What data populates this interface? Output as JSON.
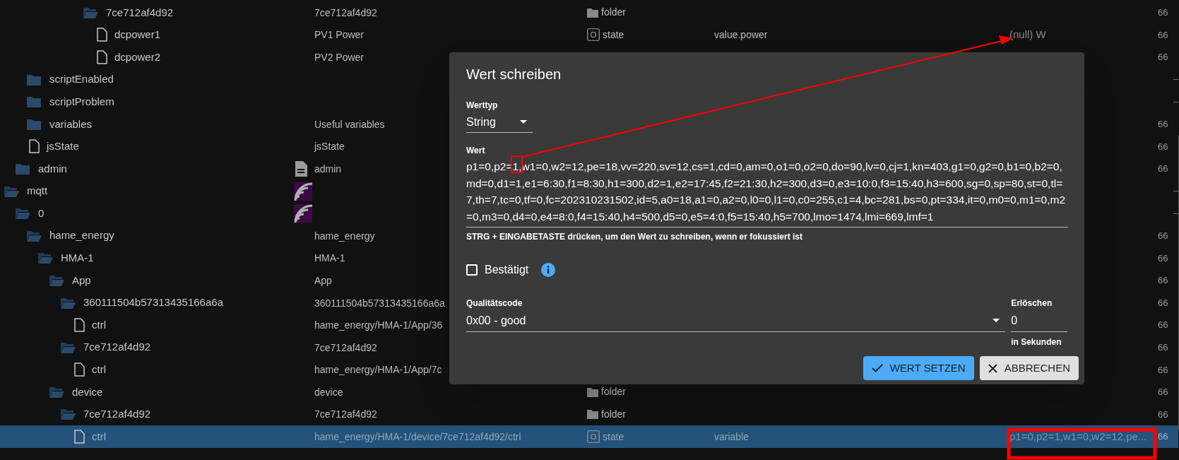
{
  "tree": [
    {
      "children": [
        {
          "children": [
            {
              "children": [
                {
                  "children": [
                    {
                      "children": [
                        {
                          "children": [
                            {
                              "children": [
                                {
                                  "name": "7ce712af4d92",
                                  "kind": "folder",
                                  "expanded": true,
                                  "selected": false,
                                  "title": "7ce712af4d92",
                                  "type": {
                                    "kind": "folder",
                                    "label": "folder"
                                  },
                                  "time": "66",
                                  "children": [
                                    {
                                      "name": "dcpower1",
                                      "kind": "file",
                                      "selected": false,
                                      "title": "PV1 Power",
                                      "type": {
                                        "kind": "state",
                                        "label": "state"
                                      },
                                      "role": "value.power",
                                      "value": "(null) W",
                                      "time": "66"
                                    },
                                    {
                                      "name": "dcpower2",
                                      "kind": "file",
                                      "selected": false,
                                      "title": "PV2 Power",
                                      "time": "66"
                                    }
                                  ]
                                }
                              ]
                            }
                          ]
                        }
                      ]
                    }
                  ]
                }
              ]
            },
            {
              "name": "scriptEnabled",
              "kind": "folder",
              "expanded": false,
              "selected": false
            },
            {
              "name": "scriptProblem",
              "kind": "folder",
              "expanded": false,
              "selected": false
            },
            {
              "name": "variables",
              "kind": "folder",
              "expanded": false,
              "selected": false,
              "title": "Useful variables",
              "time": "66"
            },
            {
              "name": "jsState",
              "kind": "file",
              "selected": false,
              "title": "jsState",
              "time": "66"
            }
          ]
        },
        {
          "name": "admin",
          "kind": "folder",
          "expanded": false,
          "selected": false,
          "title_icon": {
            "kind": "document"
          },
          "title": "admin",
          "time": "66"
        }
      ]
    },
    {
      "name": "mqtt",
      "kind": "folder",
      "expanded": true,
      "selected": false,
      "title_icon": {
        "kind": "adapter"
      },
      "children": [
        {
          "name": "0",
          "kind": "folder",
          "expanded": true,
          "selected": false,
          "title_icon": {
            "kind": "adapter"
          },
          "children": [
            {
              "name": "hame_energy",
              "kind": "folder",
              "expanded": true,
              "selected": false,
              "title": "hame_energy",
              "time": "66",
              "children": [
                {
                  "name": "HMA-1",
                  "kind": "folder",
                  "expanded": true,
                  "selected": false,
                  "title": "HMA-1",
                  "time": "66",
                  "children": [
                    {
                      "name": "App",
                      "kind": "folder",
                      "expanded": true,
                      "selected": false,
                      "title": "App",
                      "time": "66",
                      "children": [
                        {
                          "name": "360111504b57313435166a6a",
                          "kind": "folder",
                          "expanded": true,
                          "selected": false,
                          "title": "360111504b57313435166a6a",
                          "time": "66",
                          "children": [
                            {
                              "name": "ctrl",
                              "kind": "file",
                              "selected": false,
                              "title": "hame_energy/HMA-1/App/36",
                              "time": "66"
                            }
                          ]
                        },
                        {
                          "name": "7ce712af4d92",
                          "kind": "folder",
                          "expanded": true,
                          "selected": false,
                          "title": "7ce712af4d92",
                          "time": "66",
                          "children": [
                            {
                              "name": "ctrl",
                              "kind": "file",
                              "selected": false,
                              "title": "hame_energy/HMA-1/App/7c",
                              "time": "66"
                            }
                          ]
                        }
                      ]
                    },
                    {
                      "name": "device",
                      "kind": "folder",
                      "expanded": true,
                      "selected": false,
                      "title": "device",
                      "type": {
                        "kind": "folder",
                        "label": "folder"
                      },
                      "time": "66",
                      "children": [
                        {
                          "name": "7ce712af4d92",
                          "kind": "folder",
                          "expanded": true,
                          "selected": false,
                          "title": "7ce712af4d92",
                          "type": {
                            "kind": "folder",
                            "label": "folder"
                          },
                          "time": "66",
                          "children": [
                            {
                              "name": "ctrl",
                              "kind": "file",
                              "selected": true,
                              "title": "hame_energy/HMA-1/device/7ce712af4d92/ctrl",
                              "type": {
                                "kind": "state",
                                "label": "state"
                              },
                              "role": "variable",
                              "value": "p1=0,p2=1,w1=0,w2=12,pe...",
                              "time": "66"
                            }
                          ]
                        }
                      ]
                    }
                  ]
                }
              ]
            }
          ]
        }
      ]
    }
  ],
  "dialog": {
    "title": "Wert schreiben",
    "value_type": {
      "label": "Werttyp",
      "value": "String"
    },
    "value": {
      "label": "Wert",
      "text": "p1=0,p2=1,w1=0,w2=12,pe=18,vv=220,sv=12,cs=1,cd=0,am=0,o1=0,o2=0,do=90,lv=0,cj=1,kn=403,g1=0,g2=0,b1=0,b2=0,md=0,d1=1,e1=6:30,f1=8:30,h1=300,d2=1,e2=17:45,f2=21:30,h2=300,d3=0,e3=10:0,f3=15:40,h3=600,sg=0,sp=80,st=0,tl=7,th=7,tc=0,tf=0,fc=202310231502,id=5,a0=18,a1=0,a2=0,l0=0,l1=0,c0=255,c1=4,bc=281,bs=0,pt=334,it=0,m0=0,m1=0,m2=0,m3=0,d4=0,e4=8:0,f4=15:40,h4=500,d5=0,e5=4:0,f5=15:40,h5=700,lmo=1474,lmi=669,lmf=1",
      "helper": "STRG + EINGABETASTE drücken, um den Wert zu schreiben, wenn er fokussiert ist"
    },
    "confirmed": {
      "label": "Bestätigt",
      "checked": false
    },
    "quality": {
      "label": "Qualitätscode",
      "value": "0x00 - good"
    },
    "expire": {
      "label": "Erlöschen",
      "value": "0",
      "helper": "in Sekunden"
    },
    "buttons": [
      {
        "kind": "primary",
        "label": "WERT SETZEN"
      },
      {
        "kind": "secondary",
        "label": "ABBRECHEN"
      }
    ]
  }
}
